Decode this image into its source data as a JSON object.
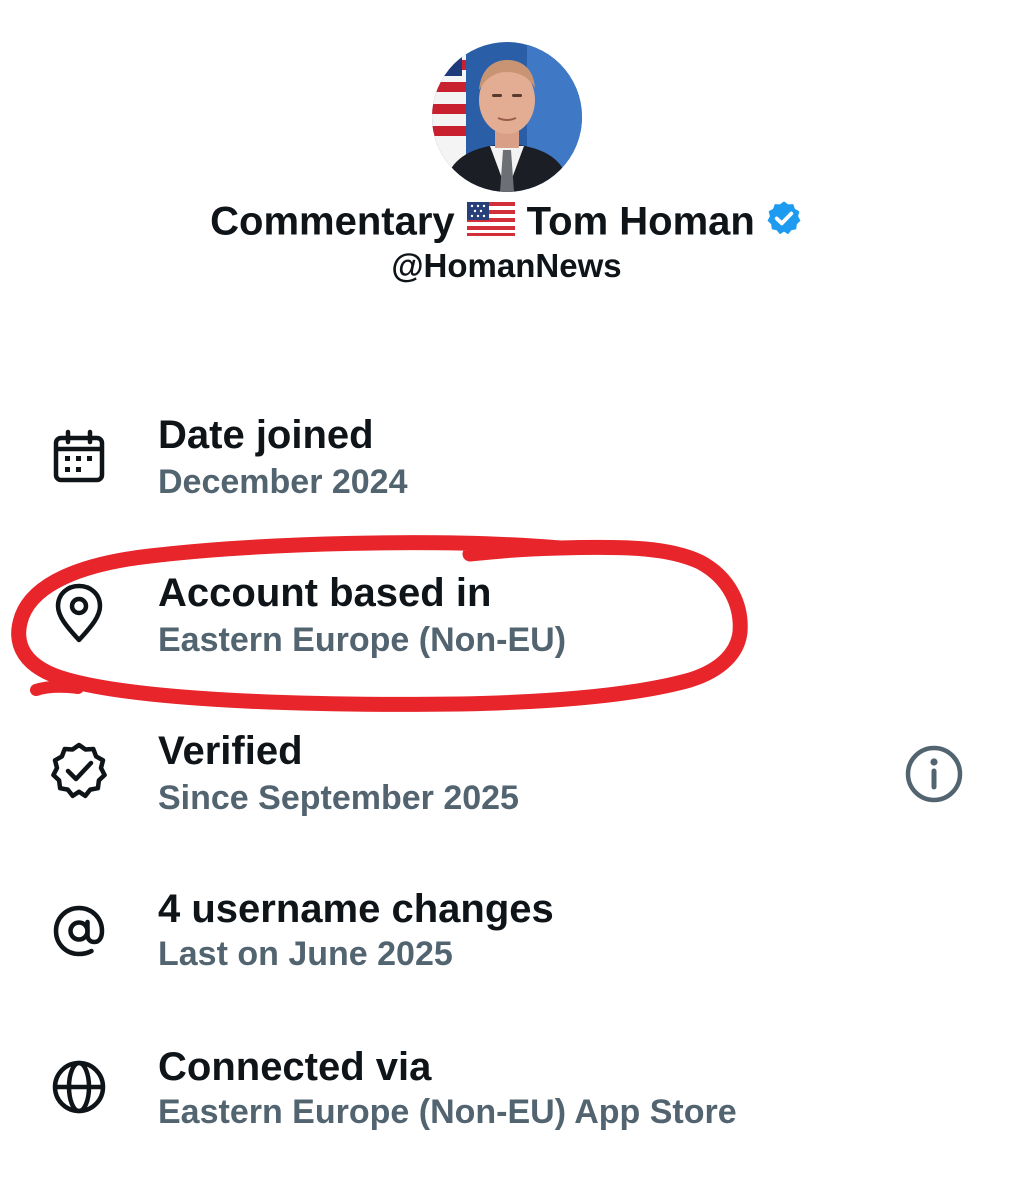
{
  "profile": {
    "name_part1": "Commentary",
    "flag_emoji": "🇺🇸",
    "name_part2": "Tom Homan",
    "handle": "@HomanNews",
    "verified_badge_color": "#1d9bf0"
  },
  "rows": [
    {
      "icon": "calendar-icon",
      "title": "Date joined",
      "subtitle": "December 2024"
    },
    {
      "icon": "location-pin-icon",
      "title": "Account based in",
      "subtitle": "Eastern Europe (Non-EU)"
    },
    {
      "icon": "verified-badge-icon",
      "title": "Verified",
      "subtitle": "Since September 2025"
    },
    {
      "icon": "at-sign-icon",
      "title": "4 username changes",
      "subtitle": "Last on June 2025"
    },
    {
      "icon": "globe-icon",
      "title": "Connected via",
      "subtitle": "Eastern Europe (Non-EU) App Store"
    }
  ],
  "colors": {
    "text_primary": "#0f1419",
    "text_secondary": "#536471",
    "highlight_marker": "#e8252b"
  }
}
